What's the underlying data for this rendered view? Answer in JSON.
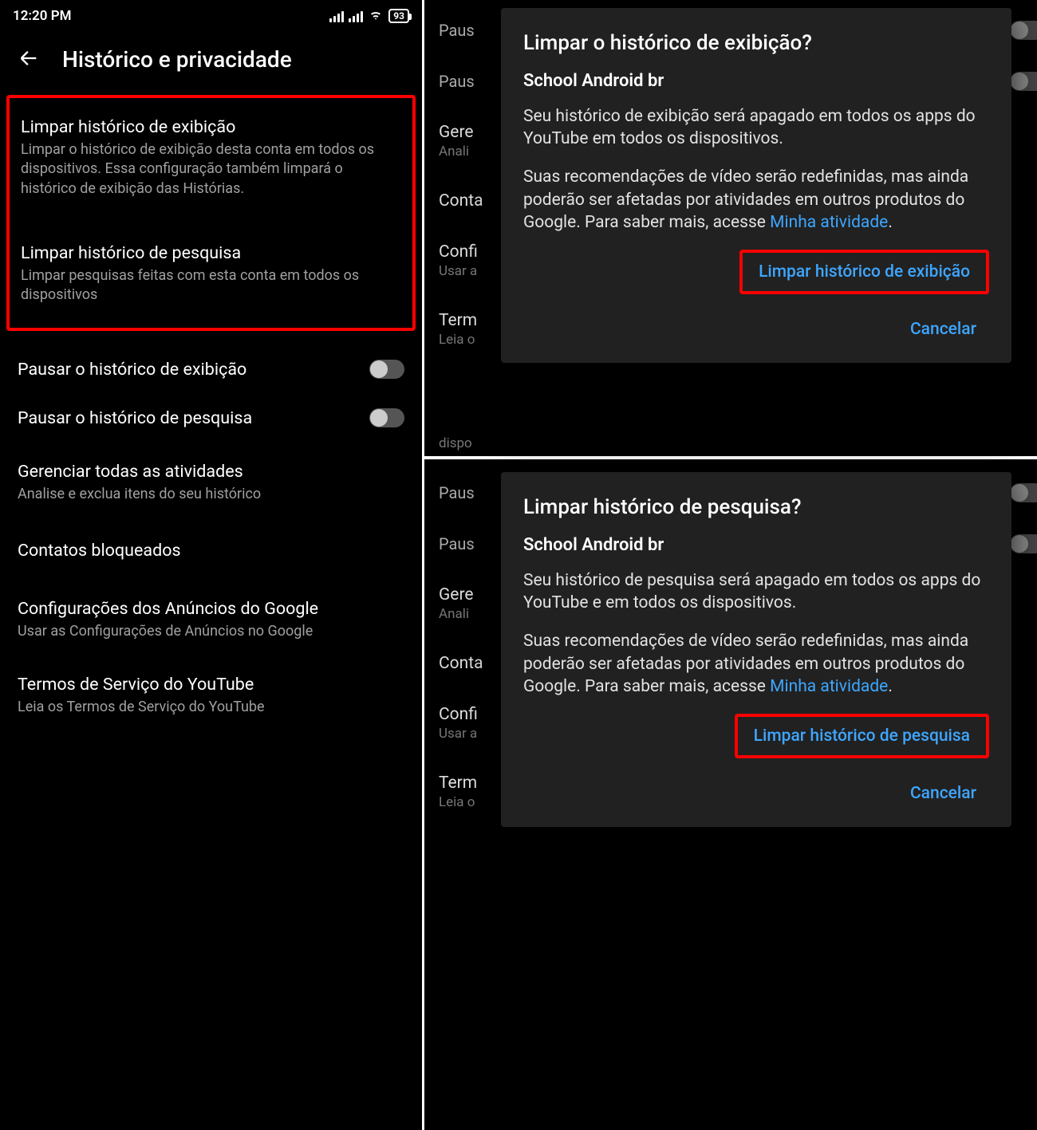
{
  "status": {
    "time": "12:20 PM",
    "battery": "93"
  },
  "header": {
    "title": "Histórico e privacidade"
  },
  "left": {
    "clear_watch_title": "Limpar histórico de exibição",
    "clear_watch_sub": "Limpar o histórico de exibição desta conta em todos os dispositivos. Essa configuração também limpará o histórico de exibição das Histórias.",
    "clear_search_title": "Limpar histórico de pesquisa",
    "clear_search_sub": "Limpar pesquisas feitas com esta conta em todos os dispositivos",
    "pause_watch": "Pausar o histórico de exibição",
    "pause_search": "Pausar o histórico de pesquisa",
    "manage_title": "Gerenciar todas as atividades",
    "manage_sub": "Analise e exclua itens do seu histórico",
    "blocked": "Contatos bloqueados",
    "ads_title": "Configurações dos Anúncios do Google",
    "ads_sub": "Usar as Configurações de Anúncios no Google",
    "tos_title": "Termos de Serviço do YouTube",
    "tos_sub": "Leia os Termos de Serviço do YouTube"
  },
  "bg": {
    "dispo": "dispo",
    "paus": "Paus",
    "gere": "Gere",
    "anali": "Anali",
    "conta": "Conta",
    "confi": "Confi",
    "usar": "Usar a",
    "term": "Term",
    "leia": "Leia o"
  },
  "dialog_watch": {
    "title": "Limpar o histórico de exibição?",
    "account": "School Android br",
    "p1": "Seu histórico de exibição será apagado em todos os apps do YouTube em todos os dispositivos.",
    "p2a": "Suas recomendações de vídeo serão redefinidas, mas ainda poderão ser afetadas por atividades em outros produtos do Google. Para saber mais, acesse ",
    "p2link": "Minha atividade",
    "confirm": "Limpar histórico de exibição",
    "cancel": "Cancelar"
  },
  "dialog_search": {
    "title": "Limpar histórico de pesquisa?",
    "account": "School Android br",
    "p1": "Seu histórico de pesquisa será apagado em todos os apps do YouTube e em todos os dispositivos.",
    "p2a": "Suas recomendações de vídeo serão redefinidas, mas ainda poderão ser afetadas por atividades em outros produtos do Google. Para saber mais, acesse ",
    "p2link": "Minha atividade",
    "confirm": "Limpar histórico de pesquisa",
    "cancel": "Cancelar"
  }
}
